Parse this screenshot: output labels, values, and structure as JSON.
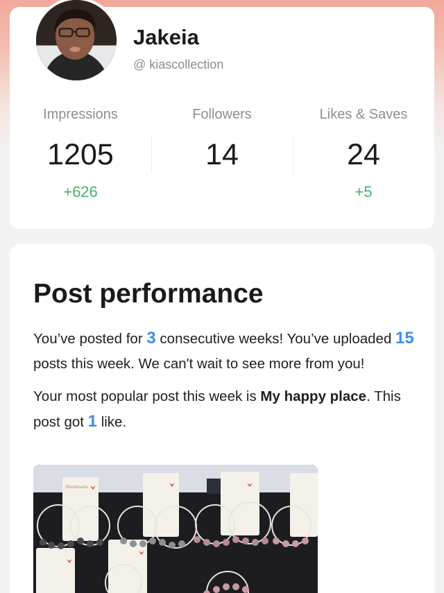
{
  "profile": {
    "name": "Jakeia",
    "handle": "@ kiascollection"
  },
  "stats": [
    {
      "label": "Impressions",
      "value": "1205",
      "delta": "+626"
    },
    {
      "label": "Followers",
      "value": "14",
      "delta": ""
    },
    {
      "label": "Likes & Saves",
      "value": "24",
      "delta": "+5"
    }
  ],
  "performance": {
    "title": "Post performance",
    "p1_a": "You’ve posted for ",
    "weeks": "3",
    "p1_b": " consecutive weeks! You’ve uploaded ",
    "posts": "15",
    "p1_c": " posts this week. We can't wait to see more from you!",
    "p2_a": "Your most popular post this week is ",
    "post_title": "My happy place",
    "p2_b": ". This post got ",
    "likes": "1",
    "p2_c": " like.",
    "image_caption": "Handmade"
  },
  "colors": {
    "accent_blue": "#3d8fe0",
    "delta_green": "#4cae6a",
    "header_pink": "#f2a89a"
  }
}
